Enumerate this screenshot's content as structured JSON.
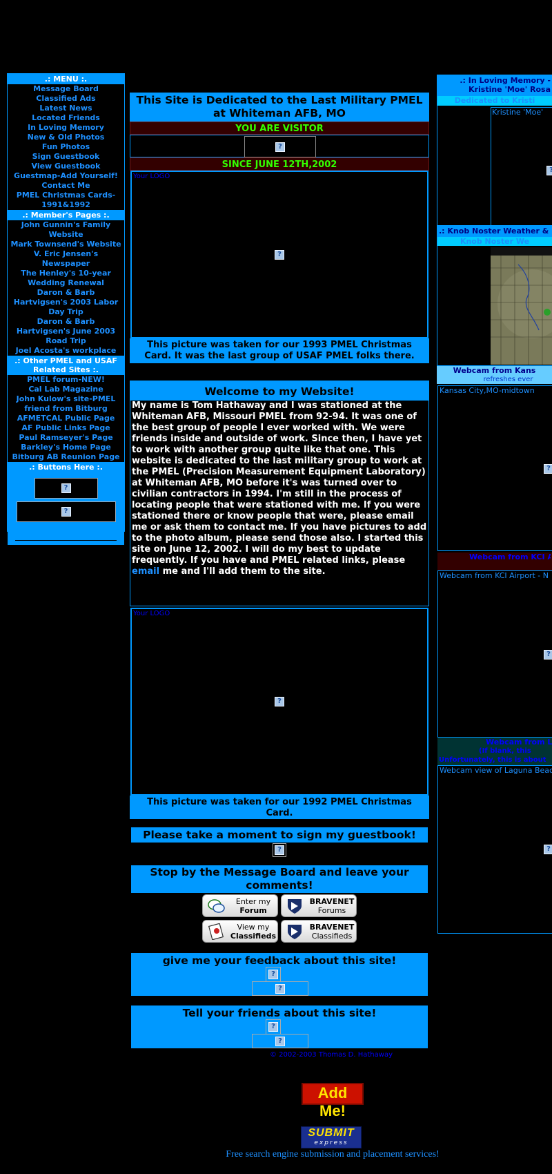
{
  "menu": {
    "header": ".: MENU :.",
    "items": [
      "Message Board",
      "Classified Ads",
      "Latest News",
      "Located Friends",
      "In Loving Memory",
      "New & Old Photos",
      "Fun Photos",
      "Sign Guestbook",
      "View Guestbook",
      "Guestmap-Add Yourself!",
      "Contact Me",
      "PMEL Christmas Cards-1991&1992"
    ],
    "members_header": ".: Member's Pages :.",
    "members": [
      "John Gunnin's Family Website",
      "Mark Townsend's Website",
      "V. Eric Jensen's Newspaper",
      "The Henley's 10-year Wedding Renewal",
      "Daron & Barb Hartvigsen's 2003 Labor Day Trip",
      "Daron & Barb Hartvigsen's June 2003 Road Trip",
      "Joel Acosta's workplace"
    ],
    "other_header": ".: Other PMEL and USAF Related Sites :.",
    "other": [
      "PMEL forum-NEW!",
      "Cal Lab Magazine",
      "John Kulow's site-PMEL friend from Bitburg",
      "AFMETCAL Public Page",
      "AF Public Links Page",
      "Paul Ramseyer's Page",
      "Barkley's Home Page",
      "Bitburg AB Reunion Page"
    ],
    "buttons_header": ".: Buttons Here :."
  },
  "center": {
    "title": "This Site is Dedicated to the Last Military PMEL at Whiteman AFB, MO",
    "visitor": "YOU ARE VISITOR",
    "since": "SINCE JUNE 12TH,2002",
    "logo_label": "Your LOGO",
    "caption1": "This picture was taken for our 1993 PMEL Christmas Card. It was the last group of USAF PMEL folks there.",
    "welcome_title": "Welcome to my Website!",
    "welcome_before": "My name is Tom Hathaway and I was stationed at the Whiteman AFB, Missouri PMEL from 92-94. It was one of the best group of people I ever worked with. We were friends inside and outside of work. Since then, I have yet to work with another group quite like that one. This website is dedicated to the last military group to work at the PMEL (Precision Measurement Equipment Laboratory) at Whiteman AFB, MO before it's was turned over to civilian contractors in 1994. I'm still in the process of locating people that were stationed with me. If you were stationed there or know people that were, please email me or ask them to contact me. If you have pictures to add to the photo album, please send those also. I started this site on June 12, 2002. I will do my best to update frequently. If you have and PMEL related links, please ",
    "welcome_link": "email",
    "welcome_after": " me and I'll add them to the site.",
    "logo_label2": "Your LOGO",
    "caption2": "This picture was taken for our 1992 PMEL Christmas Card.",
    "guestbook": "Please take a moment to sign my guestbook!",
    "message_board": "Stop by the Message Board and leave your comments!",
    "forum_buttons": [
      {
        "line1": "Enter my",
        "line2": "Forum"
      },
      {
        "line1": "BRAVENET",
        "line2": "Forums"
      },
      {
        "line1": "View my",
        "line2": "Classifieds"
      },
      {
        "line1": "BRAVENET",
        "line2": "Classifieds"
      }
    ],
    "feedback": "give me your feedback about this site!",
    "tell_friends": "Tell your friends about this site!",
    "copyright": "© 2002-2003 Thomas D. Hathaway",
    "add_me": "Add Me!",
    "submit_big": "SUBMIT",
    "submit_small": "express",
    "free_search": "Free search engine submission and placement services!"
  },
  "right": {
    "memory_header": ".: In Loving Memory - Kristine 'Moe' Rosa",
    "dedicated": "Dedicated to Kristi",
    "kristine_label": "Kristine 'Moe'",
    "weather_header": ".: Knob Noster Weather &",
    "weather_sub": "Knob Noster We",
    "webcam_kansas": "Webcam from Kans",
    "refreshes": "refreshes ever",
    "kc_label": "Kansas City,MO-midtown",
    "webcam_kci": "Webcam from KCI Ai",
    "kci_label": "Webcam from KCI Airport - N",
    "webcam_laguna": "Webcam from La",
    "laguna_sub1": "(If blank, this",
    "laguna_sub2": "Unfortunately, this is about",
    "laguna_label": "Webcam view of Laguna Beac"
  },
  "colors": {
    "accent": "#0099ff",
    "visitor_green": "#33ff00",
    "dark_red": "#330000",
    "link_blue": "#1e90ff"
  }
}
